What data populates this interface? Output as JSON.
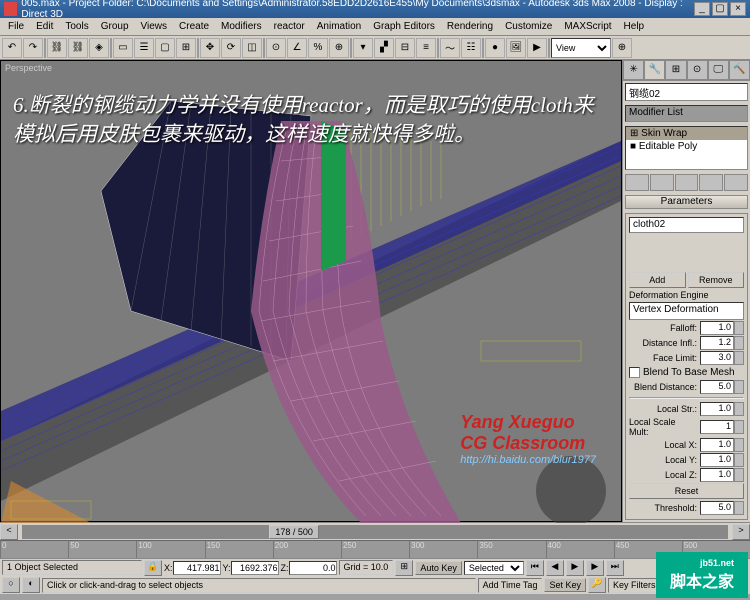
{
  "title": "005.max - Project Folder: C:\\Documents and Settings\\Administrator.58EDD2D2616E455\\My Documents\\3dsmax - Autodesk 3ds Max 2008 - Display : Direct 3D",
  "menu": [
    "File",
    "Edit",
    "Tools",
    "Group",
    "Views",
    "Create",
    "Modifiers",
    "reactor",
    "Animation",
    "Graph Editors",
    "Rendering",
    "Customize",
    "MAXScript",
    "Help"
  ],
  "viewport_label": "Perspective",
  "toolbar_view": "View",
  "annotation": "6.断裂的钢缆动力学并没有使用reactor，而是取巧的使用cloth来模拟后用皮肤包裹来驱动，这样速度就快得多啦。",
  "watermark": {
    "l1": "Yang Xueguo",
    "l2": "CG Classroom",
    "l3": "http://hi.baidu.com/blur1977"
  },
  "jb51": {
    "main": "脚本之家",
    "sub": "jb51.net"
  },
  "sidebar": {
    "object_name": "钢缆02",
    "modifier_list": "Modifier List",
    "mods": [
      {
        "name": "Skin Wrap",
        "sel": true
      },
      {
        "name": "Editable Poly",
        "sel": false
      }
    ],
    "rollout": "Parameters",
    "cloth_obj": "cloth02",
    "btns": {
      "add": "Add",
      "remove": "Remove"
    },
    "deform_label": "Deformation Engine",
    "deform_value": "Vertex Deformation",
    "falloff": {
      "label": "Falloff:",
      "val": "1.0"
    },
    "dist": {
      "label": "Distance Infl.:",
      "val": "1.2"
    },
    "facelimit": {
      "label": "Face Limit:",
      "val": "3.0"
    },
    "blend_check": "Blend To Base Mesh",
    "blend_dist": {
      "label": "Blend Distance:",
      "val": "5.0"
    },
    "localstr": {
      "label": "Local Str.:",
      "val": "1.0"
    },
    "localmult": {
      "label": "Local Scale Mult:",
      "val": "1"
    },
    "localx": {
      "label": "Local X:",
      "val": "1.0"
    },
    "localy": {
      "label": "Local Y:",
      "val": "1.0"
    },
    "localz": {
      "label": "Local Z:",
      "val": "1.0"
    },
    "reset": "Reset",
    "threshold": {
      "label": "Threshold:",
      "val": "5.0"
    }
  },
  "timeline": {
    "frame": "178 / 500",
    "ticks": [
      "0",
      "50",
      "100",
      "150",
      "200",
      "250",
      "300",
      "350",
      "400",
      "450",
      "500"
    ]
  },
  "status": {
    "selected": "1 Object Selected",
    "hint": "Click or click-and-drag to select objects",
    "x": "417.981",
    "y": "1692.376",
    "z": "0.0",
    "grid": "Grid = 10.0",
    "autokey": "Auto Key",
    "setkey": "Set Key",
    "keymode": "Selected",
    "keyfilters": "Key Filters...",
    "addtag": "Add Time Tag"
  }
}
